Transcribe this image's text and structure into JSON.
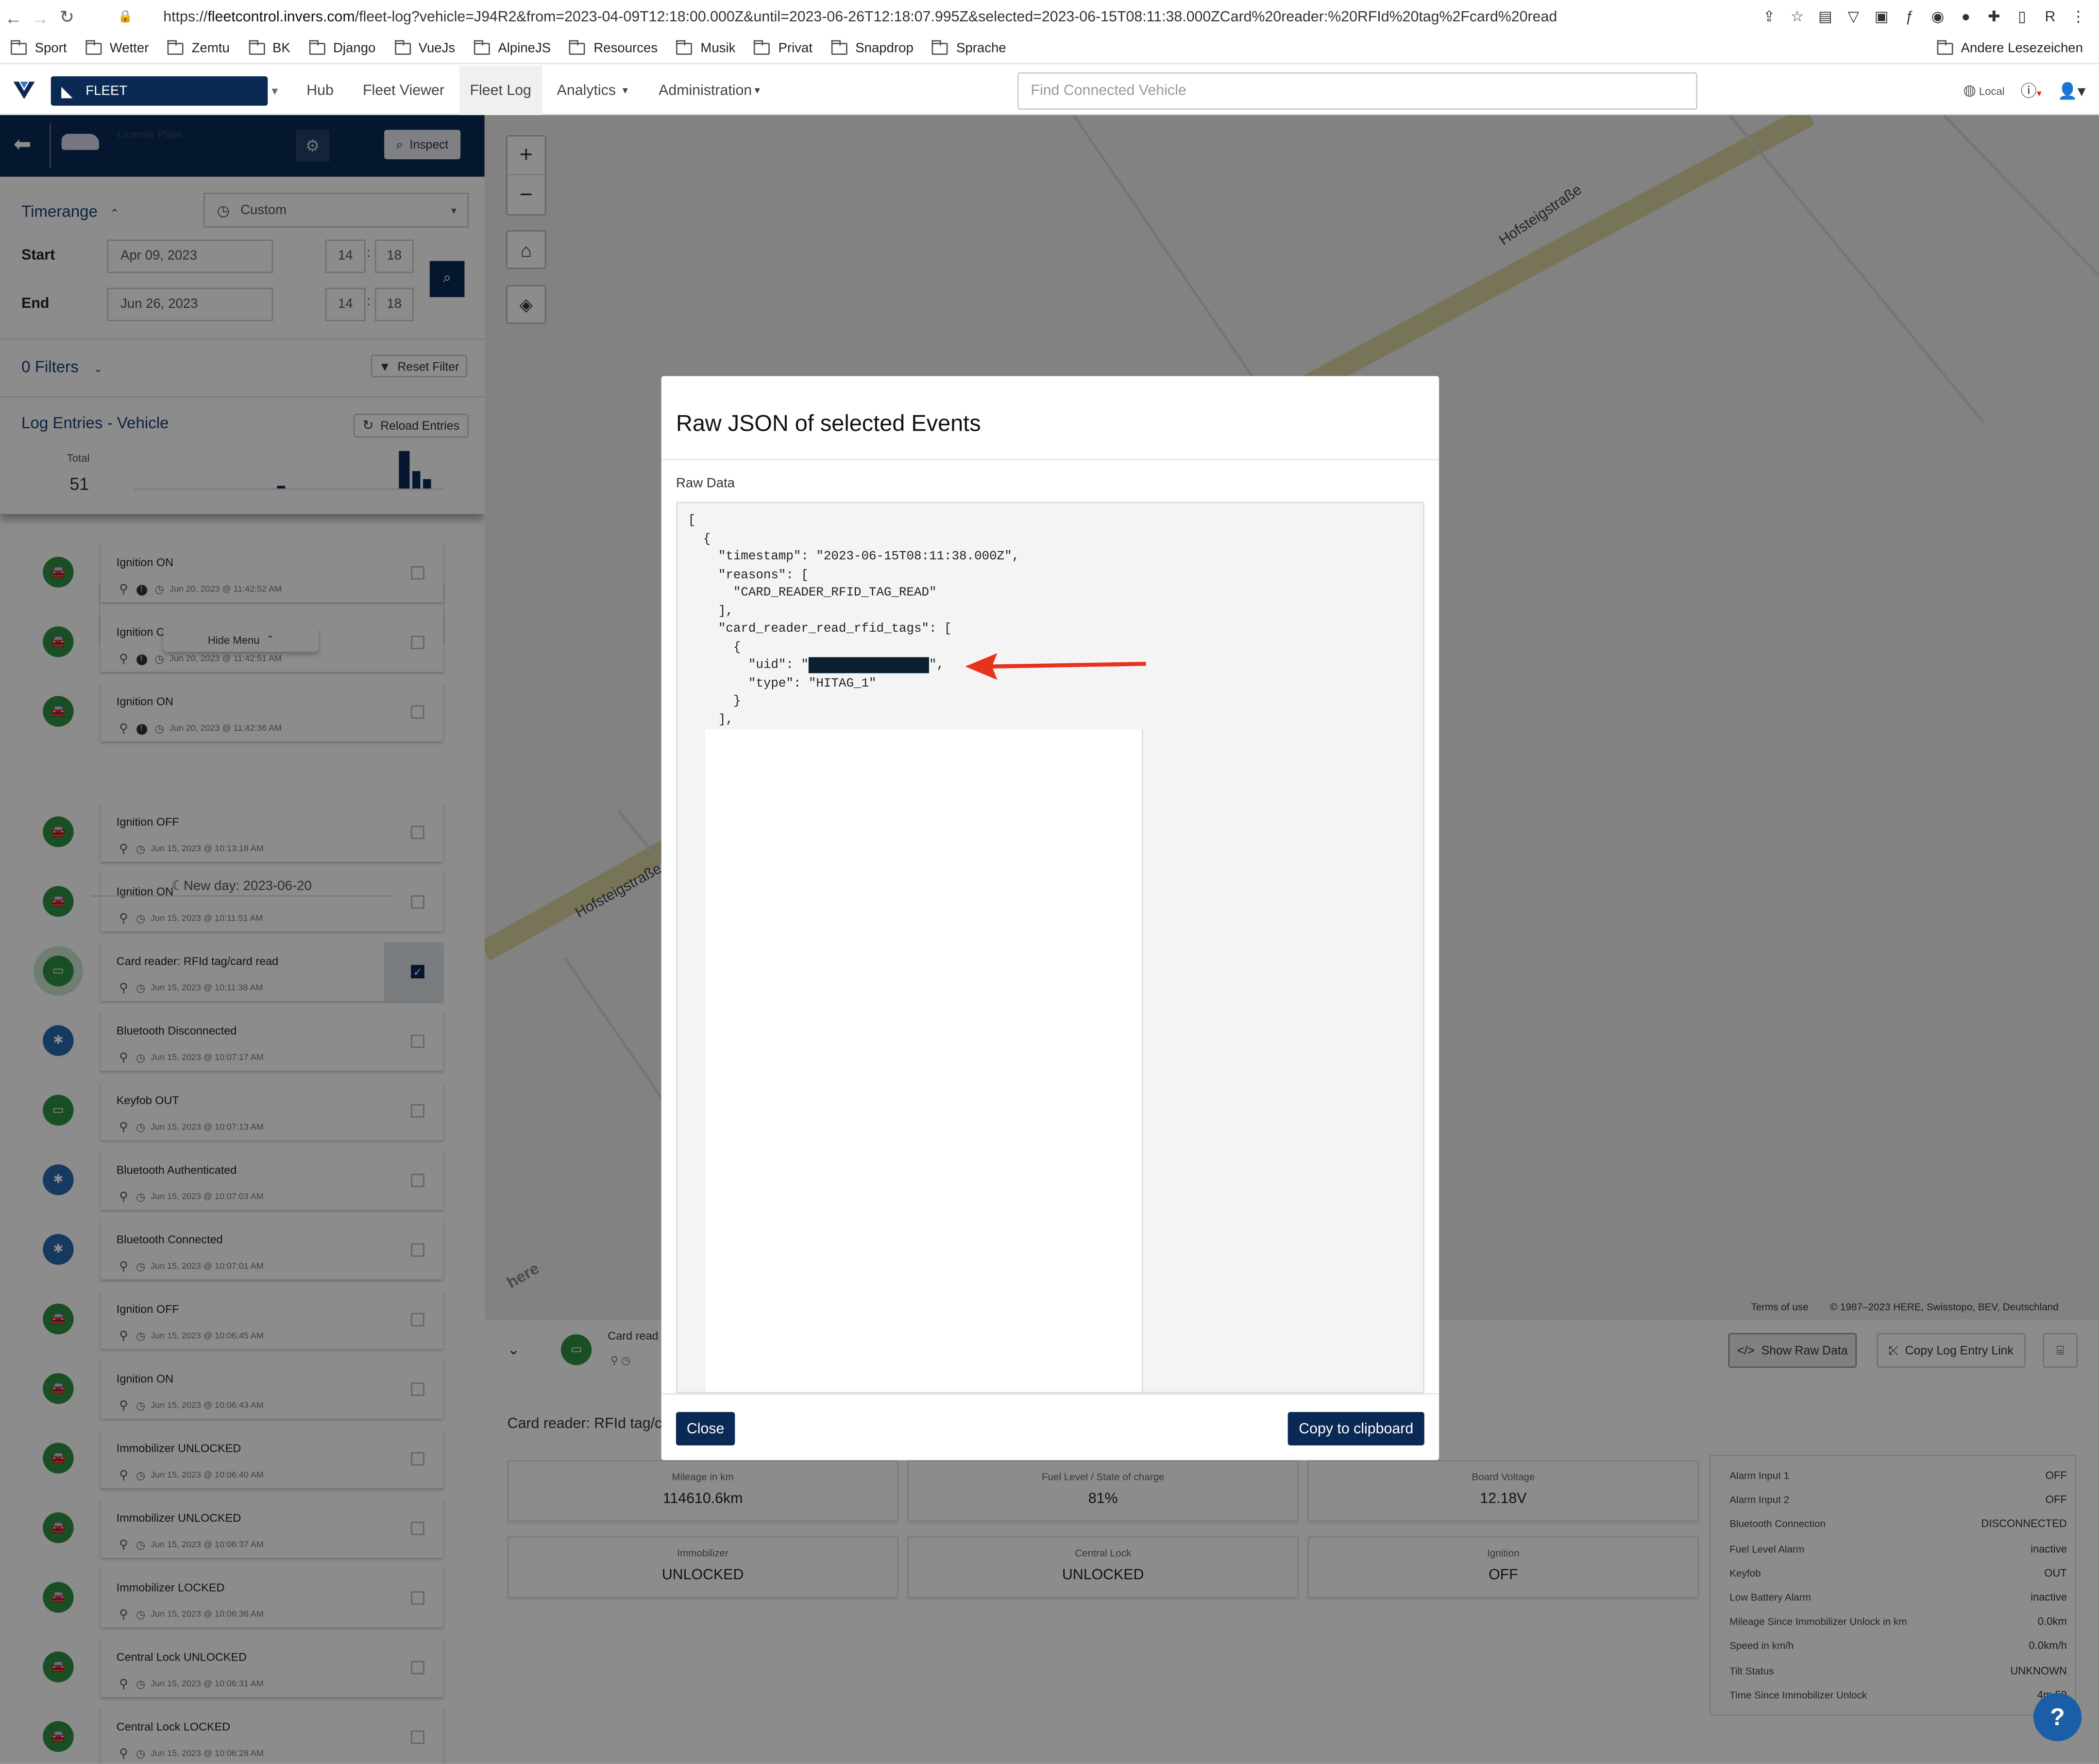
{
  "browser": {
    "url_prefix": "https://",
    "url_host": "fleetcontrol.invers.com",
    "url_rest": "/fleet-log?vehicle=J94R2&from=2023-04-09T12:18:00.000Z&until=2023-06-26T12:18:07.995Z&selected=2023-06-15T08:11:38.000ZCard%20reader:%20RFId%20tag%2Fcard%20read",
    "bookmarks": [
      "Sport",
      "Wetter",
      "Zemtu",
      "BK",
      "Django",
      "VueJs",
      "AlpineJS",
      "Resources",
      "Musik",
      "Privat",
      "Snapdrop",
      "Sprache"
    ],
    "other_bookmarks": "Andere Lesezeichen"
  },
  "appnav": {
    "fleet_label": "FLEET",
    "links": [
      "Hub",
      "Fleet Viewer",
      "Fleet Log",
      "Analytics",
      "Administration"
    ],
    "active_link": "Fleet Log",
    "search_placeholder": "Find Connected Vehicle",
    "locale": "Local"
  },
  "vehicle": {
    "plate_label": "License Plate",
    "inspect_label": "Inspect"
  },
  "timerange": {
    "label": "Timerange",
    "mode": "Custom",
    "start_label": "Start",
    "end_label": "End",
    "start_date": "Apr 09, 2023",
    "start_h": "14",
    "start_m": "18",
    "end_date": "Jun 26, 2023",
    "end_h": "14",
    "end_m": "18"
  },
  "filters": {
    "label": "0 Filters",
    "reset_label": "Reset Filter"
  },
  "log": {
    "title": "Log Entries - Vehicle",
    "reload_label": "Reload Entries",
    "total_label": "Total",
    "total_value": "51",
    "chart_bars": [
      0.08,
      0.95,
      0.45,
      0.25
    ],
    "hide_menu_label": "Hide Menu",
    "day_header": "New day: 2023-06-20",
    "entries": [
      {
        "title": "Ignition ON",
        "time": "Jun 20, 2023 @ 11:42:52 AM",
        "kind": "car",
        "warn": true
      },
      {
        "title": "Ignition OFF",
        "time": "Jun 20, 2023 @ 11:42:51 AM",
        "kind": "car",
        "warn": true
      },
      {
        "title": "Ignition ON",
        "time": "Jun 20, 2023 @ 11:42:36 AM",
        "kind": "car",
        "warn": true
      },
      {
        "title": "Ignition OFF",
        "time": "Jun 15, 2023 @ 10:13:18 AM",
        "kind": "car"
      },
      {
        "title": "Ignition ON",
        "time": "Jun 15, 2023 @ 10:11:51 AM",
        "kind": "car"
      },
      {
        "title": "Card reader: RFId tag/card read",
        "time": "Jun 15, 2023 @ 10:11:38 AM",
        "kind": "card",
        "selected": true
      },
      {
        "title": "Bluetooth Disconnected",
        "time": "Jun 15, 2023 @ 10:07:17 AM",
        "kind": "bt"
      },
      {
        "title": "Keyfob OUT",
        "time": "Jun 15, 2023 @ 10:07:13 AM",
        "kind": "card"
      },
      {
        "title": "Bluetooth Authenticated",
        "time": "Jun 15, 2023 @ 10:07:03 AM",
        "kind": "bt"
      },
      {
        "title": "Bluetooth Connected",
        "time": "Jun 15, 2023 @ 10:07:01 AM",
        "kind": "bt"
      },
      {
        "title": "Ignition OFF",
        "time": "Jun 15, 2023 @ 10:06:45 AM",
        "kind": "car"
      },
      {
        "title": "Ignition ON",
        "time": "Jun 15, 2023 @ 10:06:43 AM",
        "kind": "car"
      },
      {
        "title": "Immobilizer UNLOCKED",
        "time": "Jun 15, 2023 @ 10:06:40 AM",
        "kind": "car"
      },
      {
        "title": "Immobilizer UNLOCKED",
        "time": "Jun 15, 2023 @ 10:06:37 AM",
        "kind": "car"
      },
      {
        "title": "Immobilizer LOCKED",
        "time": "Jun 15, 2023 @ 10:06:36 AM",
        "kind": "car"
      },
      {
        "title": "Central Lock UNLOCKED",
        "time": "Jun 15, 2023 @ 10:06:31 AM",
        "kind": "car"
      },
      {
        "title": "Central Lock LOCKED",
        "time": "Jun 15, 2023 @ 10:06:28 AM",
        "kind": "car"
      }
    ]
  },
  "map": {
    "street_1": "Hofsteigstraße",
    "street_2": "Hofsteigstraße",
    "watermark": "here",
    "terms": "Terms of use",
    "copyright": "© 1987–2023 HERE, Swisstopo, BEV, Deutschland"
  },
  "detail": {
    "event_short": "Card read",
    "event_full": "Card reader: RFId tag/ca",
    "show_raw_label": "Show Raw Data",
    "copy_link_label": "Copy Log Entry Link",
    "tiles": [
      {
        "label": "Mileage in km",
        "value": "114610.6km"
      },
      {
        "label": "Fuel Level / State of charge",
        "value": "81%"
      },
      {
        "label": "Board Voltage",
        "value": "12.18V"
      },
      {
        "label": "Immobilizer",
        "value": "UNLOCKED"
      },
      {
        "label": "Central Lock",
        "value": "UNLOCKED"
      },
      {
        "label": "Ignition",
        "value": "OFF"
      }
    ],
    "stats": [
      {
        "label": "Alarm Input 1",
        "value": "OFF"
      },
      {
        "label": "Alarm Input 2",
        "value": "OFF"
      },
      {
        "label": "Bluetooth Connection",
        "value": "DISCONNECTED"
      },
      {
        "label": "Fuel Level Alarm",
        "value": "inactive"
      },
      {
        "label": "Keyfob",
        "value": "OUT"
      },
      {
        "label": "Low Battery Alarm",
        "value": "inactive"
      },
      {
        "label": "Mileage Since Immobilizer Unlock in km",
        "value": "0.0km"
      },
      {
        "label": "Speed in km/h",
        "value": "0.0km/h"
      },
      {
        "label": "Tilt Status",
        "value": "UNKNOWN"
      },
      {
        "label": "Time Since Immobilizer Unlock",
        "value": "4m 59"
      }
    ]
  },
  "modal": {
    "title": "Raw JSON of selected Events",
    "raw_label": "Raw Data",
    "code_lines": [
      "[",
      "  {",
      "    \"timestamp\": \"2023-06-15T08:11:38.000Z\",",
      "    \"reasons\": [",
      "      \"CARD_READER_RFID_TAG_READ\"",
      "    ],",
      "    \"card_reader_read_rfid_tags\": [",
      "      {",
      "        \"uid\": \"                \",",
      "        \"type\": \"HITAG_1\"",
      "      }",
      "    ],"
    ],
    "close_label": "Close",
    "copy_label": "Copy to clipboard"
  },
  "colors": {
    "navy": "#0a2a55",
    "green": "#2e9044",
    "bluetooth": "#2868ad",
    "arrow": "#e8321e"
  }
}
